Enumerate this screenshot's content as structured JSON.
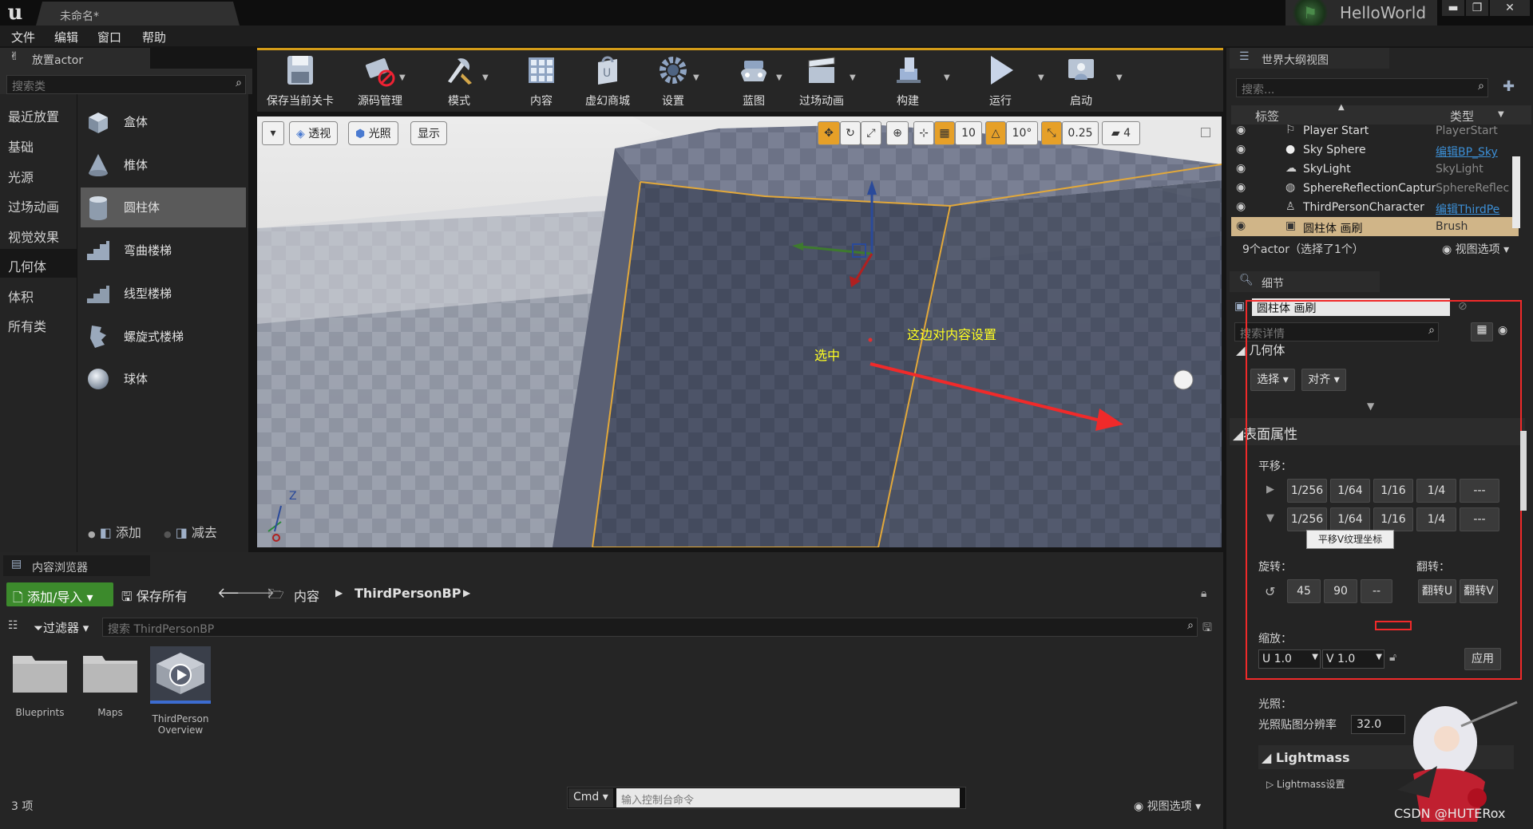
{
  "window": {
    "doc_tab": "未命名*",
    "project": "HelloWorld",
    "min": "▬",
    "max": "❐",
    "close": "✕"
  },
  "menu": [
    "文件",
    "编辑",
    "窗口",
    "帮助"
  ],
  "place_panel": {
    "title": "放置actor",
    "search_placeholder": "搜索类",
    "categories": [
      "最近放置",
      "基础",
      "光源",
      "过场动画",
      "视觉效果",
      "几何体",
      "体积",
      "所有类"
    ],
    "active_category": "几何体",
    "items": [
      "盒体",
      "椎体",
      "圆柱体",
      "弯曲楼梯",
      "线型楼梯",
      "螺旋式楼梯",
      "球体"
    ],
    "selected_item": "圆柱体",
    "add_label": "添加",
    "subtract_label": "减去"
  },
  "toolbar": [
    {
      "label": "保存当前关卡",
      "icon": "save-icon"
    },
    {
      "label": "源码管理",
      "icon": "source-control-icon"
    },
    {
      "label": "模式",
      "icon": "modes-icon"
    },
    {
      "label": "内容",
      "icon": "content-icon"
    },
    {
      "label": "虚幻商城",
      "icon": "marketplace-icon"
    },
    {
      "label": "设置",
      "icon": "settings-icon"
    },
    {
      "label": "蓝图",
      "icon": "blueprint-icon"
    },
    {
      "label": "过场动画",
      "icon": "cinematics-icon"
    },
    {
      "label": "构建",
      "icon": "build-icon"
    },
    {
      "label": "运行",
      "icon": "play-icon"
    },
    {
      "label": "启动",
      "icon": "launch-icon"
    }
  ],
  "viewport": {
    "perspective": "透视",
    "lit": "光照",
    "show": "显示",
    "grid_snap": "10",
    "rot_snap": "10°",
    "scale_snap": "0.25",
    "camera_speed": "4",
    "annotation_selected": "选中",
    "annotation_settings": "这边对内容设置",
    "axis_z": "Z"
  },
  "outliner": {
    "title": "世界大纲视图",
    "search_placeholder": "搜索...",
    "col_label": "标签",
    "col_type": "类型",
    "rows": [
      {
        "name": "Player Start",
        "type": "PlayerStart",
        "link": false
      },
      {
        "name": "Sky Sphere",
        "type": "编辑BP_Sky",
        "link": true
      },
      {
        "name": "SkyLight",
        "type": "SkyLight",
        "link": false
      },
      {
        "name": "SphereReflectionCaptur",
        "type": "SphereReflec",
        "link": false
      },
      {
        "name": "ThirdPersonCharacter",
        "type": "编辑ThirdPe",
        "link": true
      },
      {
        "name": "圆柱体 画刷",
        "type": "Brush",
        "link": false
      }
    ],
    "status": "9个actor（选择了1个）",
    "view_options": "视图选项"
  },
  "details": {
    "title": "细节",
    "name_value": "圆柱体 画刷",
    "search_placeholder": "搜索详情",
    "geometry_section": "几何体",
    "select_btn": "选择",
    "align_btn": "对齐",
    "surface_section": "表面属性",
    "pan_label": "平移：",
    "pan_values": [
      "1/256",
      "1/64",
      "1/16",
      "1/4",
      "---"
    ],
    "tooltip": "平移V纹理坐标",
    "rotate_label": "旋转：",
    "rotate_values": [
      "45",
      "90",
      "--"
    ],
    "flip_label": "翻转：",
    "flip_u": "翻转U",
    "flip_v": "翻转V",
    "scale_label": "缩放：",
    "scale_u": "U  1.0",
    "scale_v": "V  1.0",
    "apply": "应用",
    "lighting_label": "光照：",
    "lightmap_res_label": "光照贴图分辨率",
    "lightmap_res_value": "32.0",
    "lightmass_section": "Lightmass",
    "lightmass_settings": "Lightmass设置",
    "watermark": "CSDN @HUTERox"
  },
  "content_browser": {
    "title": "内容浏览器",
    "add_import": "添加/导入",
    "save_all": "保存所有",
    "path_root": "内容",
    "path_current": "ThirdPersonBP",
    "filters": "过滤器",
    "search_placeholder": "搜索 ThirdPersonBP",
    "assets": [
      {
        "name": "Blueprints",
        "kind": "folder"
      },
      {
        "name": "Maps",
        "kind": "folder"
      },
      {
        "name": "ThirdPerson Overview",
        "kind": "map"
      }
    ],
    "count": "3 项",
    "cmd": "Cmd",
    "console_placeholder": "输入控制台命令",
    "view_options": "视图选项"
  },
  "colors": {
    "accent": "#d49c18",
    "selection": "#d0b588",
    "annotation": "#ff3030",
    "link": "#3c8fd6"
  }
}
